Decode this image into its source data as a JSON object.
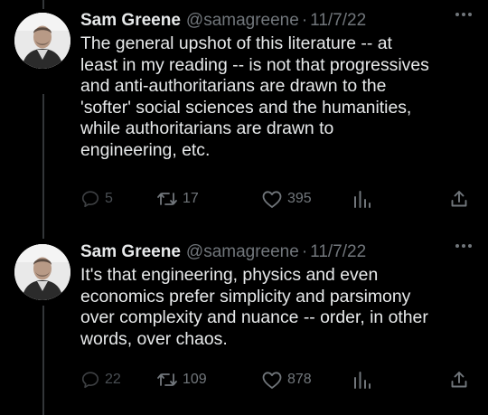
{
  "colors": {
    "background": "#000000",
    "primary_text": "#e7e9ea",
    "secondary_text": "#71767b",
    "thread_line": "#333639"
  },
  "tweets": [
    {
      "display_name": "Sam Greene",
      "handle": "@samagreene",
      "separator": "·",
      "date": "11/7/22",
      "text": "The general upshot of this literature -- at\nleast in my reading -- is not that progressives\nand anti-authoritarians are drawn to the\n'softer' social sciences and the humanities,\nwhile authoritarians are drawn to\nengineering, etc.",
      "reply_count": "5",
      "retweet_count": "17",
      "like_count": "395",
      "icons": {
        "more": "more-horizontal-icon",
        "reply": "reply-icon",
        "retweet": "retweet-icon",
        "like": "heart-icon",
        "views": "views-icon",
        "share": "share-icon"
      }
    },
    {
      "display_name": "Sam Greene",
      "handle": "@samagreene",
      "separator": "·",
      "date": "11/7/22",
      "text": "It's that engineering, physics and even\neconomics prefer simplicity and parsimony\nover complexity and nuance -- order, in other\nwords, over chaos.",
      "reply_count": "22",
      "retweet_count": "109",
      "like_count": "878",
      "icons": {
        "more": "more-horizontal-icon",
        "reply": "reply-icon",
        "retweet": "retweet-icon",
        "like": "heart-icon",
        "views": "views-icon",
        "share": "share-icon"
      }
    }
  ]
}
